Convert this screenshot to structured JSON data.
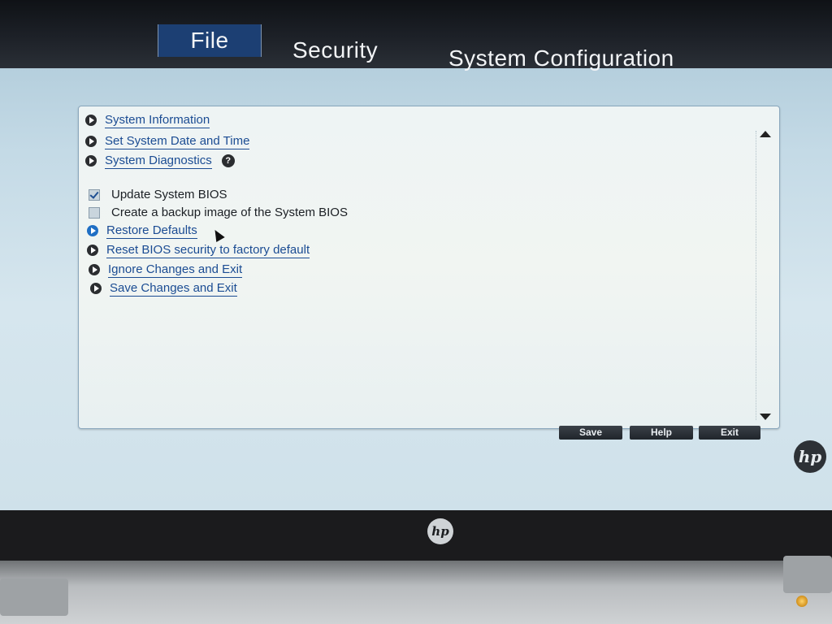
{
  "tabs": [
    {
      "label": "File",
      "active": true
    },
    {
      "label": "Security",
      "active": false
    },
    {
      "label": "System Configuration",
      "active": false
    }
  ],
  "menu": {
    "links": [
      {
        "label": "System Information",
        "icon": "arrow-bullet-icon"
      },
      {
        "label": "Set System Date and Time",
        "icon": "arrow-bullet-icon"
      },
      {
        "label": "System Diagnostics",
        "icon": "arrow-bullet-icon",
        "help": "?"
      }
    ],
    "checkboxes": [
      {
        "label": "Update System BIOS",
        "checked": true
      },
      {
        "label": "Create a backup image of the System BIOS",
        "checked": false
      }
    ],
    "actions": [
      {
        "label": "Restore Defaults",
        "selected": true
      },
      {
        "label": "Reset BIOS security to factory default",
        "selected": false
      },
      {
        "label": "Ignore Changes and Exit",
        "selected": false
      },
      {
        "label": "Save Changes and Exit",
        "selected": false
      }
    ]
  },
  "buttons": {
    "save": "Save",
    "help": "Help",
    "exit": "Exit"
  },
  "brand": {
    "logo_screen": "hp",
    "logo_bezel": "hp"
  },
  "colors": {
    "tab_active_bg": "#1c3f73",
    "link": "#1b4c93",
    "selected_bullet": "#1f6fc4"
  }
}
